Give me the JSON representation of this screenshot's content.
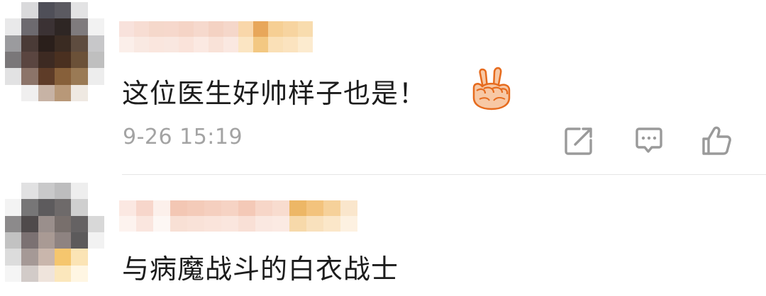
{
  "comments": [
    {
      "author_name_pixels": [
        "#f8e2dc",
        "#fbefea",
        "#f7ddd3",
        "#f9e9e2",
        "#f5d8cb",
        "#fae6de",
        "#f6d8cc",
        "#f9e7e0",
        "#f5d4c6",
        "#fae3da",
        "#f6d9cd",
        "#fbe9e2",
        "#f4d2c3",
        "#f9e2d8",
        "#f5d7ca",
        "#fae8e1",
        "#f9d7aa",
        "#fbe5c3",
        "#e8a75a",
        "#f3c882",
        "#f6cf94",
        "#fae0b7",
        "#f7d4a0",
        "#fbe3bf",
        "#f8dcae",
        "#fcebcf"
      ],
      "avatar_pixels": [
        "#ffffff",
        "#d9d9db",
        "#4f4f58",
        "#5b5a61",
        "#e3e3e4",
        "#ffffff",
        "#e9e9ea",
        "#6d6a6f",
        "#3b3234",
        "#2e2624",
        "#7f7b7d",
        "#f2f2f2",
        "#9b9b9e",
        "#4a3b37",
        "#2a1f1b",
        "#3a2b22",
        "#5e4c3f",
        "#c7c7c9",
        "#7a7779",
        "#5a4540",
        "#3d2a22",
        "#4a3020",
        "#6b5138",
        "#bfbfbf",
        "#e2e2e3",
        "#8c7469",
        "#5e3c28",
        "#87603a",
        "#9a7a55",
        "#ededed",
        "#ffffff",
        "#f0efef",
        "#c7b3a5",
        "#b89878",
        "#efe9e2",
        "#ffffff"
      ],
      "text": "这位医生好帅样子也是！",
      "emoji": "victory-hand-emoji",
      "time": "9-26 15:19",
      "actions": [
        "share",
        "comment",
        "like"
      ]
    },
    {
      "author_name_pixels": [
        "#fbe8e2",
        "#fdf3ef",
        "#f7d6cb",
        "#fae6df",
        "#fcf0eb",
        "#fdf7f4",
        "#f3c7b4",
        "#f8e0d5",
        "#f4cbb9",
        "#f9e2d8",
        "#f5cfbf",
        "#fae4db",
        "#f6d3c4",
        "#fae6de",
        "#f4c9b7",
        "#f9e0d6",
        "#f7d6c8",
        "#fae8e1",
        "#f8dccf",
        "#fbeae3",
        "#edb766",
        "#f7d9aa",
        "#f3c37d",
        "#f9e1bd",
        "#f6d19a",
        "#fbe7c9",
        "#fae6cc",
        "#fdf1e1"
      ],
      "avatar_pixels": [
        "#ffffff",
        "#e1e1e2",
        "#c9c9ca",
        "#bdbdbe",
        "#eeeeee",
        "#ffffff",
        "#f3f3f3",
        "#777677",
        "#5d5b5d",
        "#6e6a6a",
        "#cfcfcf",
        "#ffffff",
        "#8c8a8b",
        "#4f4a4b",
        "#9a8f8c",
        "#786f6c",
        "#656263",
        "#d8d8d8",
        "#c2c2c2",
        "#7b7172",
        "#a99a94",
        "#8e8381",
        "#5c5a5b",
        "#f2f2f2",
        "#dcdcdc",
        "#a59996",
        "#c9b6ac",
        "#f5c66e",
        "#fbe4b5",
        "#ffffff",
        "#f5f5f5",
        "#d2cbc8",
        "#efe4dc",
        "#fbe7bc",
        "#fff6e3",
        "#ffffff"
      ],
      "text": "与病魔战斗的白衣战士"
    }
  ],
  "colors": {
    "text": "#1c1c1c",
    "meta": "#a3a3a3",
    "icon": "#9a9a9a",
    "divider": "#e6e6e6",
    "emoji_skin": "#f7c8a5",
    "emoji_outline": "#e66b1e"
  }
}
